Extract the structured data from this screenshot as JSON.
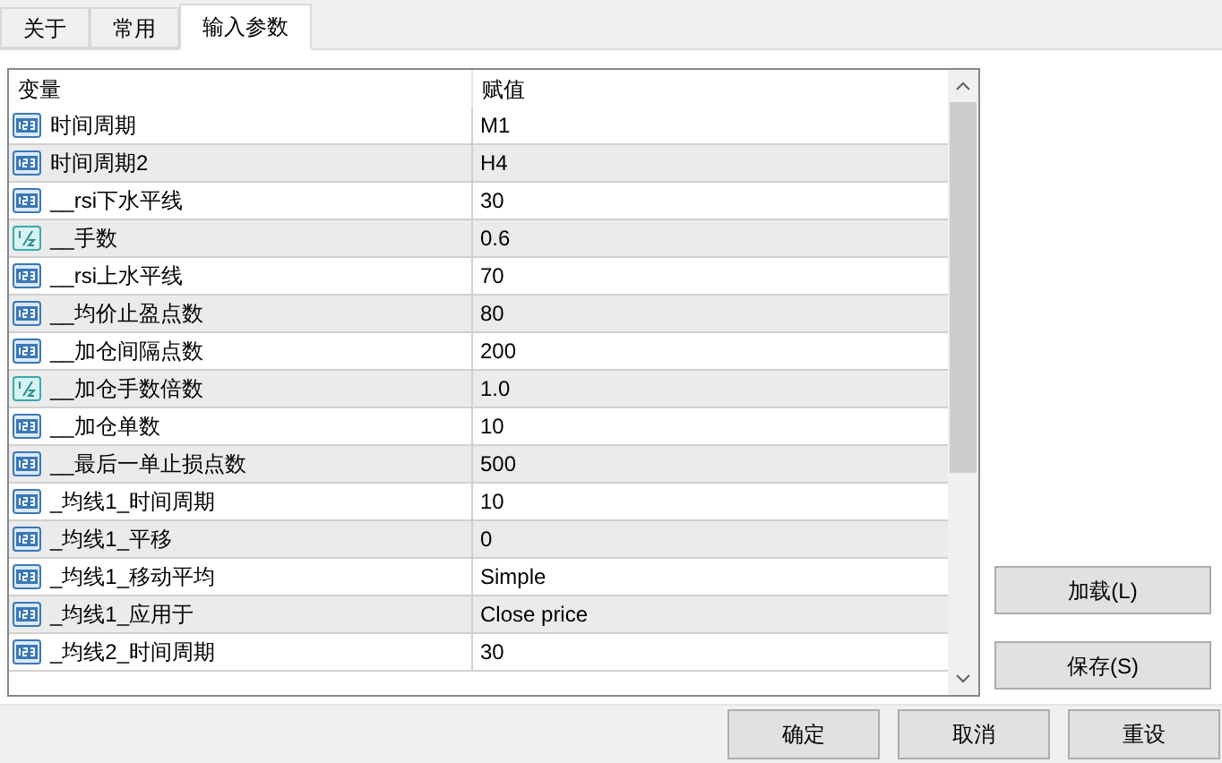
{
  "tabs": [
    {
      "label": "关于",
      "selected": false
    },
    {
      "label": "常用",
      "selected": false
    },
    {
      "label": "输入参数",
      "selected": true
    }
  ],
  "table": {
    "columns": [
      "变量",
      "赋值"
    ],
    "rows": [
      {
        "kind": "int",
        "name": "时间周期",
        "value": "M1"
      },
      {
        "kind": "int",
        "name": "时间周期2",
        "value": "H4"
      },
      {
        "kind": "int",
        "name": "__rsi下水平线",
        "value": "30"
      },
      {
        "kind": "double",
        "name": "__手数",
        "value": "0.6"
      },
      {
        "kind": "int",
        "name": "__rsi上水平线",
        "value": "70"
      },
      {
        "kind": "int",
        "name": "__均价止盈点数",
        "value": "80"
      },
      {
        "kind": "int",
        "name": "__加仓间隔点数",
        "value": "200"
      },
      {
        "kind": "double",
        "name": "__加仓手数倍数",
        "value": "1.0"
      },
      {
        "kind": "int",
        "name": "__加仓单数",
        "value": "10"
      },
      {
        "kind": "int",
        "name": "__最后一单止损点数",
        "value": "500"
      },
      {
        "kind": "int",
        "name": "_均线1_时间周期",
        "value": "10"
      },
      {
        "kind": "int",
        "name": "_均线1_平移",
        "value": "0"
      },
      {
        "kind": "int",
        "name": "_均线1_移动平均",
        "value": "Simple"
      },
      {
        "kind": "int",
        "name": "_均线1_应用于",
        "value": "Close price"
      },
      {
        "kind": "int",
        "name": "_均线2_时间周期",
        "value": "30"
      }
    ]
  },
  "side_buttons": [
    "加载(L)",
    "保存(S)"
  ],
  "bottom_buttons": [
    "确定",
    "取消",
    "重设"
  ]
}
